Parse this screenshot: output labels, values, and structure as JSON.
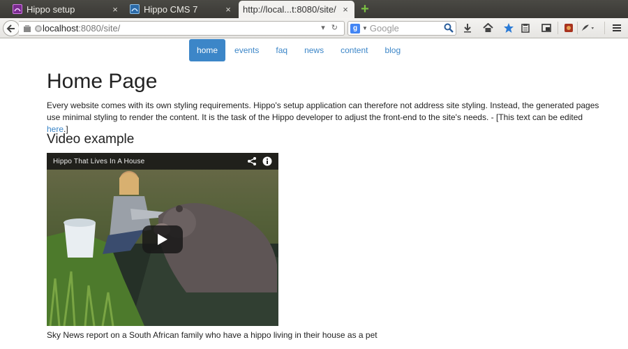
{
  "browser": {
    "tabs": [
      {
        "label": "Hippo setup",
        "close": "×"
      },
      {
        "label": "Hippo CMS 7",
        "close": "×"
      },
      {
        "label": "http://local...t:8080/site/",
        "close": "×"
      }
    ],
    "url": {
      "host": "localhost",
      "rest": ":8080/site/"
    },
    "search": {
      "engine_glyph": "g",
      "placeholder": "Google"
    },
    "icons": [
      "back-icon",
      "new-tab-icon",
      "download-icon",
      "home-icon",
      "bookmark-star-icon",
      "clipboard-icon",
      "screenshot-icon",
      "addon-icon",
      "feather-icon",
      "menu-icon"
    ]
  },
  "site": {
    "nav": [
      "home",
      "events",
      "faq",
      "news",
      "content",
      "blog"
    ],
    "title": "Home Page",
    "intro_text": "Every website comes with its own styling requirements. Hippo's setup application can therefore not address site styling. Instead, the generated pages use minimal styling to render the content. It is the task of the Hippo developer to adjust the front-end to the site's needs. - [This text can be edited ",
    "intro_link": "here",
    "intro_end": ".]",
    "video_heading": "Video example",
    "video": {
      "title": "Hippo That Lives In A House"
    },
    "caption": "Sky News report on a South African family who have a hippo living in their house as a pet"
  },
  "colors": {
    "accent": "#3c86c8",
    "tabstrip": "#3a3935"
  }
}
